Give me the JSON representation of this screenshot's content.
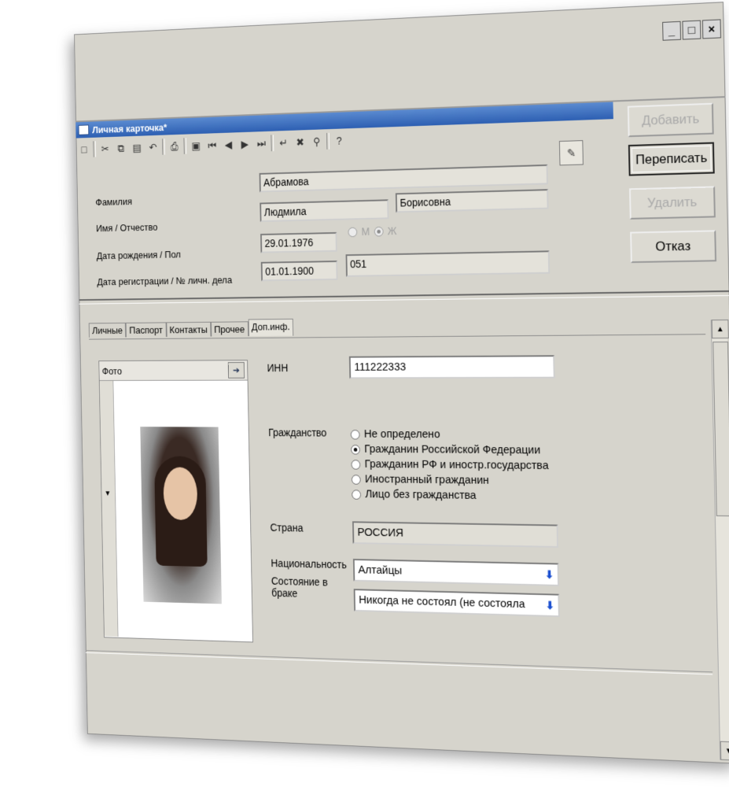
{
  "window": {
    "title": "Личная карточка*",
    "controls": {
      "minimize": "_",
      "maximize": "□",
      "close": "×"
    }
  },
  "toolbar": {
    "icons": [
      "new-icon",
      "cut-icon",
      "copy-icon",
      "paste-icon",
      "undo-icon",
      "print-icon",
      "save-icon",
      "first-record-icon",
      "prev-record-icon",
      "next-record-icon",
      "last-record-icon",
      "enter-icon",
      "delete-record-icon",
      "filter-icon",
      "help-icon"
    ]
  },
  "header": {
    "labels": {
      "surname": "Фамилия",
      "name_patronymic": "Имя / Отчество",
      "birth_sex": "Дата рождения / Пол",
      "reg_file": "Дата регистрации / № личн. дела"
    },
    "surname": "Абрамова",
    "first_name": "Людмила",
    "patronymic": "Борисовна",
    "birth_date": "29.01.1976",
    "sex": {
      "male": "М",
      "female": "Ж",
      "selected": "Ж"
    },
    "reg_date": "01.01.1900",
    "file_no": "051"
  },
  "buttons": {
    "add": "Добавить",
    "save": "Переписать",
    "delete": "Удалить",
    "cancel": "Отказ"
  },
  "tabs": [
    "Личные",
    "Паспорт",
    "Контакты",
    "Прочее",
    "Доп.инф."
  ],
  "active_tab": "Доп.инф.",
  "photo": {
    "label": "Фото"
  },
  "details": {
    "inn_label": "ИНН",
    "inn": "111222333",
    "citizenship_label": "Гражданство",
    "citizenship_options": [
      "Не определено",
      "Гражданин Российской Федерации",
      "Гражданин РФ и иностр.государства",
      "Иностранный гражданин",
      "Лицо без гражданства"
    ],
    "citizenship_selected": "Гражданин Российской Федерации",
    "country_label": "Страна",
    "country": "РОССИЯ",
    "nationality_label": "Национальность",
    "nationality": "Алтайцы",
    "marital_label": "Состояние в браке",
    "marital": "Никогда не состоял (не состояла"
  }
}
